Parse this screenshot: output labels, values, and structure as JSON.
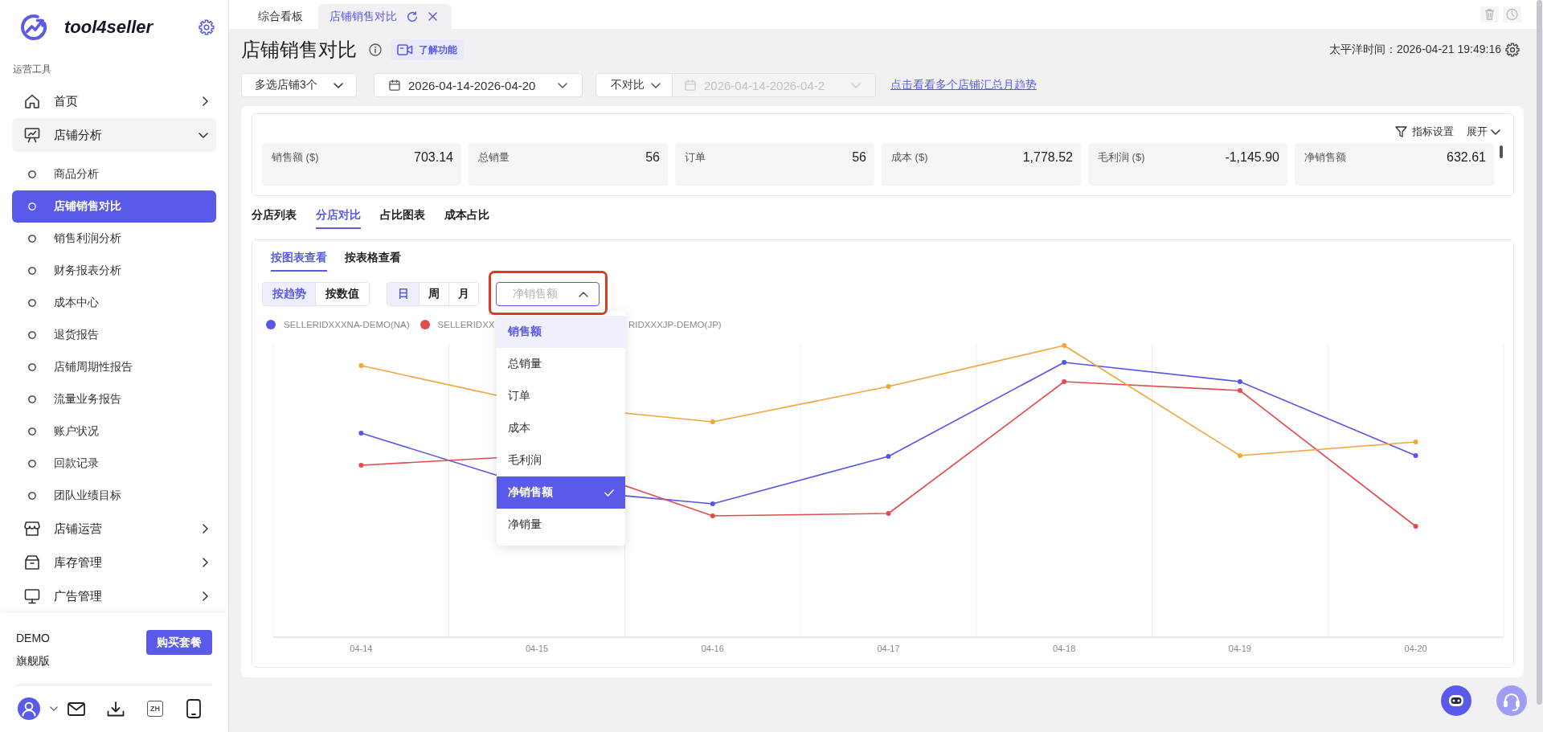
{
  "sidebar": {
    "brand": "tool4seller",
    "section": "运营工具",
    "menu": [
      {
        "label": "首页",
        "expanded": false
      },
      {
        "label": "店铺分析",
        "expanded": true,
        "children": [
          {
            "label": "商品分析",
            "selected": false
          },
          {
            "label": "店铺销售对比",
            "selected": true
          },
          {
            "label": "销售利润分析",
            "selected": false
          },
          {
            "label": "财务报表分析",
            "selected": false
          },
          {
            "label": "成本中心",
            "selected": false
          },
          {
            "label": "退货报告",
            "selected": false
          },
          {
            "label": "店铺周期性报告",
            "selected": false
          },
          {
            "label": "流量业务报告",
            "selected": false
          },
          {
            "label": "账户状况",
            "selected": false
          },
          {
            "label": "回款记录",
            "selected": false
          },
          {
            "label": "团队业绩目标",
            "selected": false
          }
        ]
      },
      {
        "label": "店铺运营",
        "expanded": false
      },
      {
        "label": "库存管理",
        "expanded": false
      },
      {
        "label": "广告管理",
        "expanded": false
      }
    ],
    "account": {
      "name": "DEMO",
      "plan": "旗舰版",
      "buy_button": "购买套餐"
    },
    "language": "ZH"
  },
  "tabs": [
    {
      "label": "综合看板",
      "selected": false
    },
    {
      "label": "店铺销售对比",
      "selected": true
    }
  ],
  "header": {
    "title": "店铺销售对比",
    "feature_button": "了解功能",
    "clock": "太平洋时间：2026-04-21 19:49:16"
  },
  "filters": {
    "store_select": "多选店铺3个",
    "date_range": "2026-04-14-2026-04-20",
    "compare_select": "不对比",
    "compare_range": {
      "value": "2026-04-14-2026-04-2",
      "disabled": true
    },
    "summary_link": "点击看看多个店铺汇总月趋势"
  },
  "metrics": {
    "settings_button": "指标设置",
    "expand_button": "展开",
    "cards": [
      {
        "label": "销售额 ($)",
        "value": "703.14"
      },
      {
        "label": "总销量",
        "value": "56"
      },
      {
        "label": "订单",
        "value": "56"
      },
      {
        "label": "成本 ($)",
        "value": "1,778.52"
      },
      {
        "label": "毛利润 ($)",
        "value": "-1,145.90"
      },
      {
        "label": "净销售额",
        "value": "632.61"
      }
    ]
  },
  "section_tabs": [
    {
      "label": "分店列表",
      "selected": false
    },
    {
      "label": "分店对比",
      "selected": true
    },
    {
      "label": "占比图表",
      "selected": false
    },
    {
      "label": "成本占比",
      "selected": false
    }
  ],
  "chart_panel": {
    "view_tabs": [
      {
        "label": "按图表查看",
        "selected": true
      },
      {
        "label": "按表格查看",
        "selected": false
      }
    ],
    "modes": [
      {
        "label": "按趋势",
        "selected": true
      },
      {
        "label": "按数值",
        "selected": false
      }
    ],
    "periods": [
      {
        "label": "日",
        "selected": true
      },
      {
        "label": "周",
        "selected": false
      },
      {
        "label": "月",
        "selected": false
      }
    ],
    "metric_select": {
      "value": "净销售额",
      "open": true,
      "highlighted": true,
      "options": [
        {
          "label": "销售额",
          "hovered": true,
          "selected": false
        },
        {
          "label": "总销量",
          "hovered": false,
          "selected": false
        },
        {
          "label": "订单",
          "hovered": false,
          "selected": false
        },
        {
          "label": "成本",
          "hovered": false,
          "selected": false
        },
        {
          "label": "毛利润",
          "hovered": false,
          "selected": false
        },
        {
          "label": "净销售额",
          "hovered": false,
          "selected": true
        },
        {
          "label": "净销量",
          "hovered": false,
          "selected": false
        }
      ]
    },
    "legend": [
      {
        "kind": "dot-label",
        "label": "SELLERIDXXXNA-DEMO(NA)",
        "color": "#5856e6"
      },
      {
        "kind": "dot-label",
        "label": "SELLERIDXX",
        "color": "#e24c4f"
      },
      {
        "kind": "label",
        "label": "RIDXXXJP-DEMO(JP)",
        "color": "#f3a43b"
      }
    ],
    "x_axis_labels": [
      "04-14",
      "04-15",
      "04-16",
      "04-17",
      "04-18",
      "04-19",
      "04-20"
    ]
  }
}
